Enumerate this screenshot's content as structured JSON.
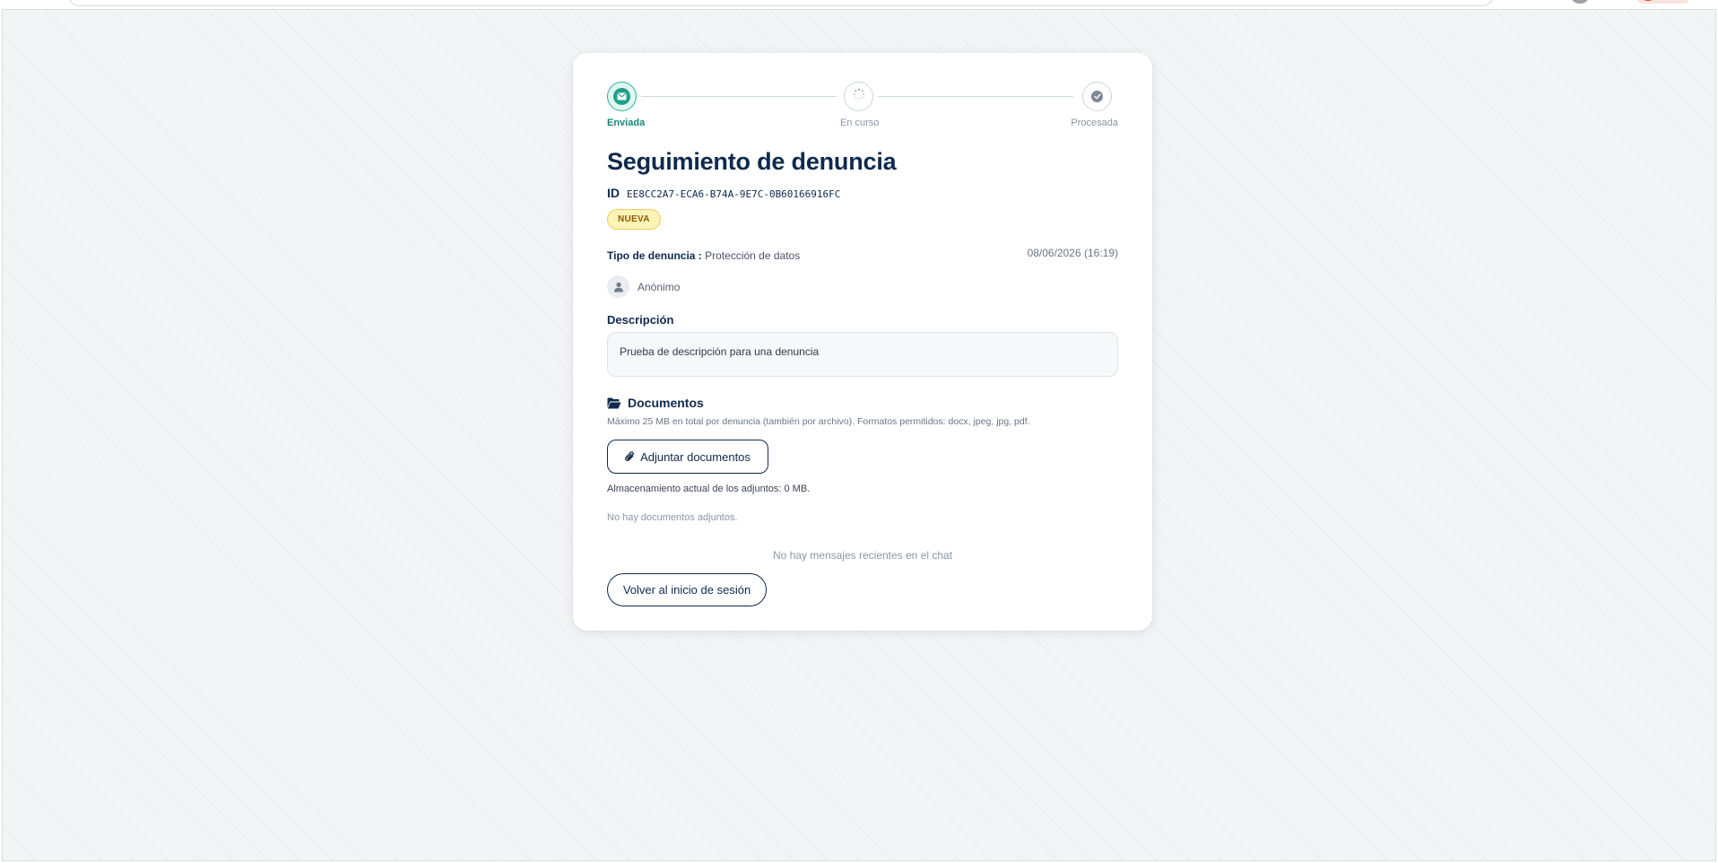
{
  "stepper": {
    "steps": [
      {
        "label": "Enviada",
        "icon": "envelope-icon",
        "state": "active"
      },
      {
        "label": "En curso",
        "icon": "spinner-icon",
        "state": "pending"
      },
      {
        "label": "Procesada",
        "icon": "check-circle-icon",
        "state": "pending"
      }
    ]
  },
  "report": {
    "title": "Seguimiento de denuncia",
    "id_label": "ID",
    "id_value": "EE8CC2A7-ECA6-B74A-9E7C-0B60166916FC",
    "status_badge": "NUEVA",
    "type_label": "Tipo de denuncia :",
    "type_value": "Protección de datos",
    "date": "08/06/2026 (16:19)",
    "author": "Anónimo",
    "description_label": "Descripción",
    "description_text": "Prueba de descripción para una denuncia"
  },
  "documents": {
    "title": "Documentos",
    "hint": "Máximo 25 MB en total por denuncia (también por archivo). Formatos permitidos: docx, jpeg, jpg, pdf.",
    "attach_button": "Adjuntar documentos",
    "storage_text": "Almacenamiento actual de los adjuntos: 0 MB.",
    "empty_text": "No hay documentos adjuntos."
  },
  "chat": {
    "empty_text": "No hay mensajes recientes en el chat"
  },
  "actions": {
    "back_button": "Volver al inicio de sesión"
  },
  "colors": {
    "primary": "#0f2a4d",
    "success": "#138a75",
    "badge_bg": "#fff3b8",
    "background": "#f3f4f6"
  }
}
